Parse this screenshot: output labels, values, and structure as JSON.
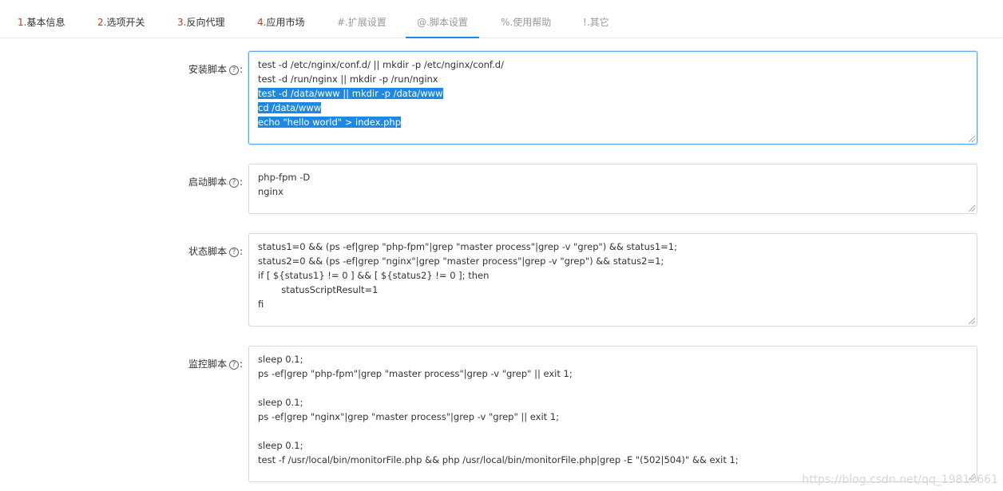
{
  "tabs": [
    {
      "prefix": "1.",
      "label": "基本信息"
    },
    {
      "prefix": "2.",
      "label": "选项开关"
    },
    {
      "prefix": "3.",
      "label": "反向代理"
    },
    {
      "prefix": "4.",
      "label": "应用市场"
    },
    {
      "prefix": "#.",
      "label": "扩展设置"
    },
    {
      "prefix": "@.",
      "label": "脚本设置"
    },
    {
      "prefix": "%.",
      "label": "使用帮助"
    },
    {
      "prefix": "!.",
      "label": "其它"
    }
  ],
  "active_tab": "@.脚本设置",
  "help_icon": "?",
  "colon": ":",
  "fields": {
    "install": {
      "label": "安装脚本",
      "lines": [
        "test -d /etc/nginx/conf.d/ || mkdir -p /etc/nginx/conf.d/",
        "test -d /run/nginx || mkdir -p /run/nginx",
        "test -d /data/www || mkdir -p /data/www",
        "cd /data/www",
        "echo \"hello world\" > index.php"
      ]
    },
    "start": {
      "label": "启动脚本",
      "lines": [
        "php-fpm -D",
        "nginx"
      ]
    },
    "status": {
      "label": "状态脚本",
      "lines": [
        "status1=0 && (ps -ef|grep \"php-fpm\"|grep \"master process\"|grep -v \"grep\") && status1=1;",
        "status2=0 && (ps -ef|grep \"nginx\"|grep \"master process\"|grep -v \"grep\") && status2=1;",
        "if [ ${status1} != 0 ] && [ ${status2} != 0 ]; then",
        "        statusScriptResult=1",
        "fi"
      ]
    },
    "monitor": {
      "label": "监控脚本",
      "lines": [
        "sleep 0.1;",
        "ps -ef|grep \"php-fpm\"|grep \"master process\"|grep -v \"grep\" || exit 1;",
        "",
        "sleep 0.1;",
        "ps -ef|grep \"nginx\"|grep \"master process\"|grep -v \"grep\" || exit 1;",
        "",
        "sleep 0.1;",
        "test -f /usr/local/bin/monitorFile.php && php /usr/local/bin/monitorFile.php|grep -E \"(502|504)\" && exit 1;"
      ]
    }
  },
  "watermark": "https://blog.csdn.net/qq_19810661",
  "colors": {
    "accent": "#1e88e5",
    "tab_number": "#c0392b",
    "focus_border": "#5aa9f2"
  }
}
